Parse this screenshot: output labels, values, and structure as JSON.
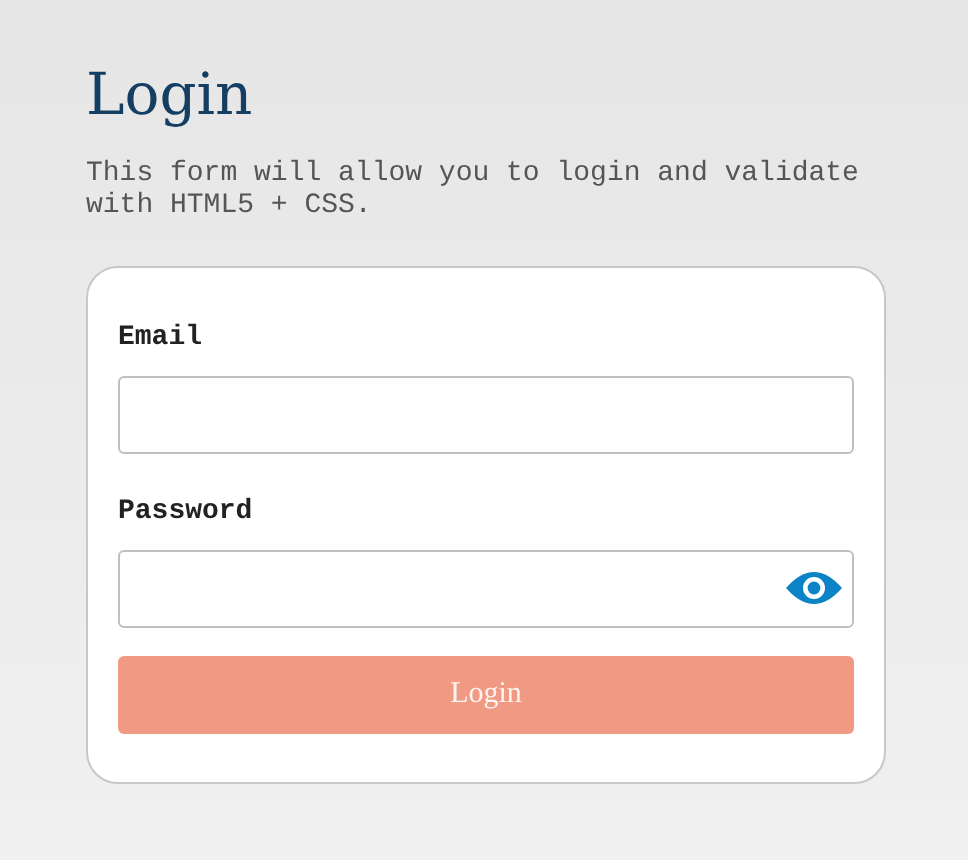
{
  "title": "Login",
  "description": "This form will allow you to login and validate with HTML5 + CSS.",
  "fields": [
    {
      "label": "Email",
      "kind": "plain"
    },
    {
      "label": "Password",
      "kind": "secret"
    }
  ],
  "submit": {
    "label": "Login",
    "disabled": true
  }
}
